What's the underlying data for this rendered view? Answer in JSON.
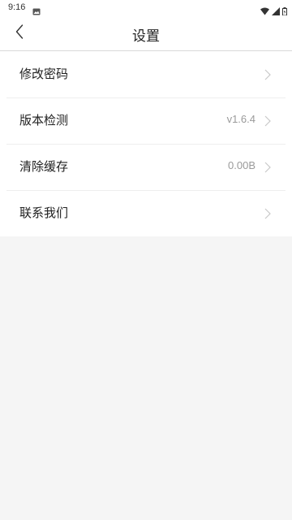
{
  "status_bar": {
    "time": "9:16",
    "icons": [
      "image-notification-icon",
      "wifi-icon",
      "signal-icon",
      "battery-icon"
    ]
  },
  "header": {
    "title": "设置",
    "back_icon": "chevron-left-icon"
  },
  "settings": {
    "items": [
      {
        "label": "修改密码",
        "value": ""
      },
      {
        "label": "版本检测",
        "value": "v1.6.4"
      },
      {
        "label": "清除缓存",
        "value": "0.00B"
      },
      {
        "label": "联系我们",
        "value": ""
      }
    ]
  },
  "colors": {
    "background": "#f5f5f5",
    "surface": "#ffffff",
    "text": "#222222",
    "secondary_text": "#9a9a9a",
    "chevron": "#c8c8c8",
    "divider": "#eeeeee"
  }
}
